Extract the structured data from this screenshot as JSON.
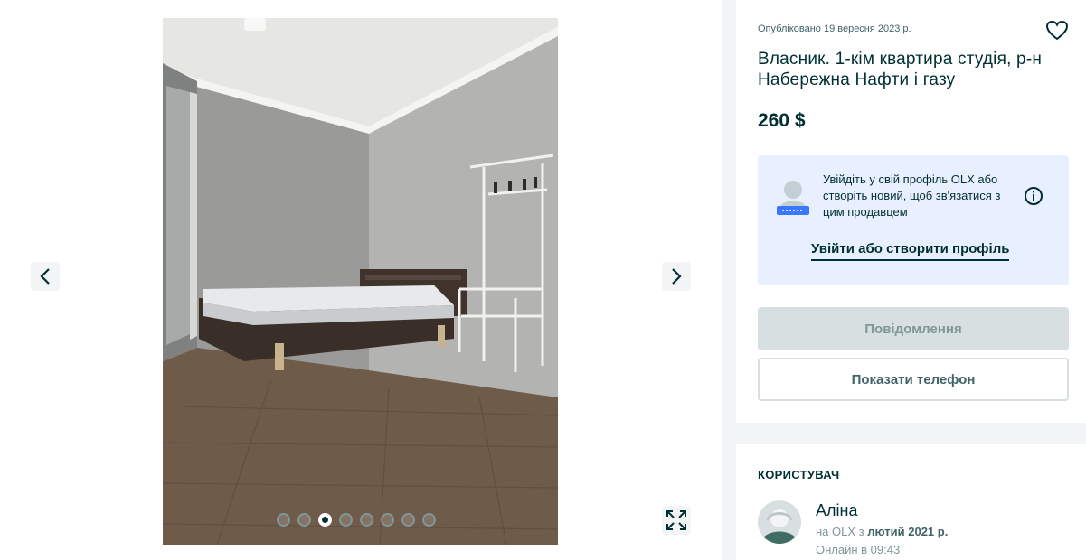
{
  "listing": {
    "posted": "Опубліковано 19 вересня 2023 р.",
    "title": "Власник. 1-кім квартира студія, р-н Набережна Нафти і газу",
    "price": "260 $"
  },
  "gallery": {
    "photo_count": 8,
    "active_index": 2
  },
  "login_prompt": {
    "text": "Увійдіть у свій профіль OLX або створіть новий, щоб зв'язатися з цим продавцем",
    "link": "Увійти або створити профіль"
  },
  "buttons": {
    "message": "Повідомлення",
    "phone": "Показати телефон"
  },
  "user": {
    "heading": "КОРИСТУВАЧ",
    "name": "Аліна",
    "since_prefix": "на OLX з",
    "since_date": "лютий 2021 р.",
    "online": "Онлайн в 09:43"
  },
  "colors": {
    "brand_dark": "#002f34",
    "login_bg": "#e8efff",
    "disabled_btn": "#d8dfe0"
  },
  "icons": [
    "chevron-left-icon",
    "chevron-right-icon",
    "expand-icon",
    "heart-icon",
    "info-icon",
    "avatar-icon"
  ]
}
